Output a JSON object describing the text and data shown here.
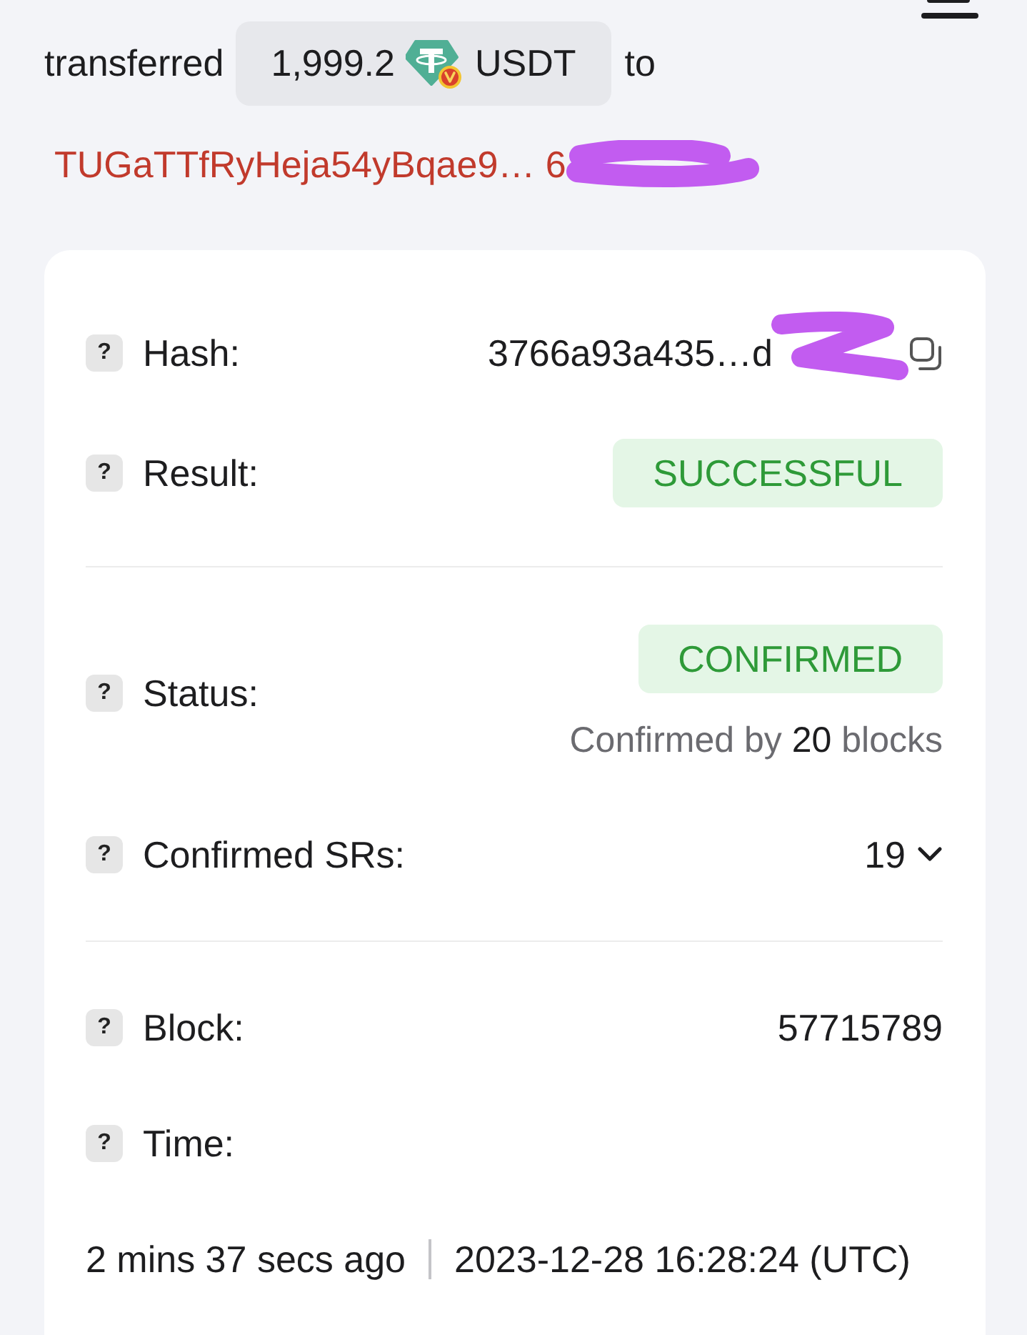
{
  "transfer": {
    "verb": "transferred",
    "amount": "1,999.2",
    "token": "USDT",
    "preposition": "to",
    "recipient": "TUGaTTfRyHeja54yBqae9… 6",
    "recipient_redacted": true
  },
  "details": {
    "sections": [
      {
        "rows": [
          {
            "kind": "copyable",
            "hint": "?",
            "label": "Hash:",
            "value": "3766a93a435…d",
            "redacted": true
          },
          {
            "kind": "badge",
            "hint": "?",
            "label": "Result:",
            "badge": "SUCCESSFUL"
          }
        ]
      },
      {
        "rows": [
          {
            "kind": "status",
            "hint": "?",
            "label": "Status:",
            "badge": "CONFIRMED",
            "note": "Confirmed by **20** blocks"
          },
          {
            "kind": "dropdown",
            "hint": "?",
            "label": "Confirmed SRs:",
            "value": "19",
            "expanded": false
          }
        ]
      },
      {
        "rows": [
          {
            "kind": "text",
            "hint": "?",
            "label": "Block:",
            "value": "57715789"
          },
          {
            "kind": "time",
            "hint": "?",
            "label": "Time:",
            "relative": "2 mins 37 secs ago",
            "timestamp": "2023-12-28 16:28:24 (UTC)"
          }
        ]
      }
    ]
  }
}
